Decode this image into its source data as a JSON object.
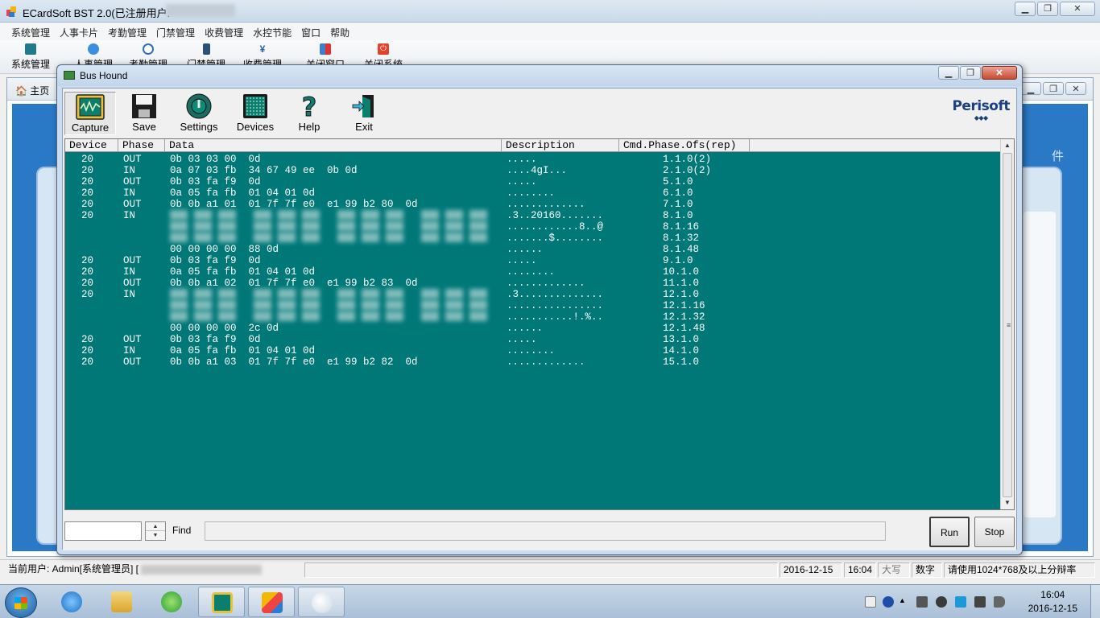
{
  "app": {
    "title": "ECardSoft  BST 2.0(已注册用户:",
    "menu": [
      "系统管理",
      "人事卡片",
      "考勤管理",
      "门禁管理",
      "收费管理",
      "水控节能",
      "窗口",
      "帮助"
    ],
    "toolbar": [
      "系统管理",
      "人事管理",
      "考勤管理",
      "门禁管理",
      "收费管理",
      "关闭窗口",
      "关闭系统"
    ],
    "tab_home": "主页",
    "side_text": "件",
    "status": {
      "user": "当前用户: Admin[系统管理员]  [",
      "date": "2016-12-15",
      "time": "16:04",
      "caps": "大写",
      "num": "数字",
      "hint": "请使用1024*768及以上分辩率"
    }
  },
  "bushound": {
    "title": "Bus Hound",
    "tools": [
      "Capture",
      "Save",
      "Settings",
      "Devices",
      "Help",
      "Exit"
    ],
    "brand": "Perisoft",
    "brand_dots": "◆◆◆",
    "columns": [
      "Device",
      "Phase",
      "Data",
      "Description",
      "Cmd.Phase.Ofs(rep)"
    ],
    "rows": [
      {
        "dev": "20",
        "phase": "OUT",
        "data": "0b 03 03 00  0d",
        "desc": ".....",
        "cmd": "1.1.0(2)"
      },
      {
        "dev": "20",
        "phase": "IN",
        "data": "0a 07 03 fb  34 67 49 ee  0b 0d",
        "desc": "....4gI...",
        "cmd": "2.1.0(2)"
      },
      {
        "dev": "20",
        "phase": "OUT",
        "data": "0b 03 fa f9  0d",
        "desc": ".....",
        "cmd": "5.1.0"
      },
      {
        "dev": "20",
        "phase": "IN",
        "data": "0a 05 fa fb  01 04 01 0d",
        "desc": "........",
        "cmd": "6.1.0"
      },
      {
        "dev": "20",
        "phase": "OUT",
        "data": "0b 0b a1 01  01 7f 7f e0  e1 99 b2 80  0d",
        "desc": ".............",
        "cmd": "7.1.0"
      },
      {
        "dev": "20",
        "phase": "IN",
        "data": "",
        "desc": ".3..20160.......",
        "cmd": "8.1.0",
        "blur": true
      },
      {
        "dev": "",
        "phase": "",
        "data": "",
        "desc": "............8..@",
        "cmd": "8.1.16",
        "blur": true
      },
      {
        "dev": "",
        "phase": "",
        "data": "",
        "desc": ".......$........",
        "cmd": "8.1.32",
        "blur": true
      },
      {
        "dev": "",
        "phase": "",
        "data": "00 00 00 00  88 0d",
        "desc": "......",
        "cmd": "8.1.48"
      },
      {
        "dev": "20",
        "phase": "OUT",
        "data": "0b 03 fa f9  0d",
        "desc": ".....",
        "cmd": "9.1.0"
      },
      {
        "dev": "20",
        "phase": "IN",
        "data": "0a 05 fa fb  01 04 01 0d",
        "desc": "........",
        "cmd": "10.1.0"
      },
      {
        "dev": "20",
        "phase": "OUT",
        "data": "0b 0b a1 02  01 7f 7f e0  e1 99 b2 83  0d",
        "desc": ".............",
        "cmd": "11.1.0"
      },
      {
        "dev": "20",
        "phase": "IN",
        "data": "",
        "desc": ".3..............",
        "cmd": "12.1.0",
        "blur": true
      },
      {
        "dev": "",
        "phase": "",
        "data": "",
        "desc": "................",
        "cmd": "12.1.16",
        "blur": true
      },
      {
        "dev": "",
        "phase": "",
        "data": "",
        "desc": "...........!.%..",
        "cmd": "12.1.32",
        "blur": true
      },
      {
        "dev": "",
        "phase": "",
        "data": "00 00 00 00  2c 0d",
        "desc": "......",
        "cmd": "12.1.48"
      },
      {
        "dev": "20",
        "phase": "OUT",
        "data": "0b 03 fa f9  0d",
        "desc": ".....",
        "cmd": "13.1.0"
      },
      {
        "dev": "20",
        "phase": "IN",
        "data": "0a 05 fa fb  01 04 01 0d",
        "desc": "........",
        "cmd": "14.1.0"
      },
      {
        "dev": "20",
        "phase": "OUT",
        "data": "0b 0b a1 03  01 7f 7f e0  e1 99 b2 82  0d",
        "desc": ".............",
        "cmd": "15.1.0"
      }
    ],
    "find_label": "Find",
    "run": "Run",
    "stop": "Stop"
  },
  "taskbar": {
    "time": "16:04",
    "date": "2016-12-15"
  }
}
